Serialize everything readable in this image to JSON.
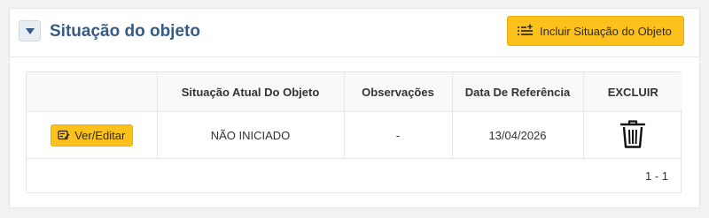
{
  "panel": {
    "title": "Situação do objeto",
    "add_button_label": "Incluir Situação do Objeto"
  },
  "table": {
    "headers": [
      "",
      "Situação Atual Do Objeto",
      "Observações",
      "Data De Referência",
      "EXCLUIR"
    ],
    "rows": [
      {
        "edit_label": "Ver/Editar",
        "situacao": "NÃO INICIADO",
        "observacoes": "-",
        "data_referencia": "13/04/2026"
      }
    ]
  },
  "pagination": {
    "range": "1 - 1"
  },
  "colors": {
    "accent": "#fcc21b",
    "title": "#345b89"
  },
  "icons": {
    "toggle": "caret-down-icon",
    "add": "list-plus-icon",
    "edit": "edit-note-icon",
    "delete": "trash-icon"
  }
}
